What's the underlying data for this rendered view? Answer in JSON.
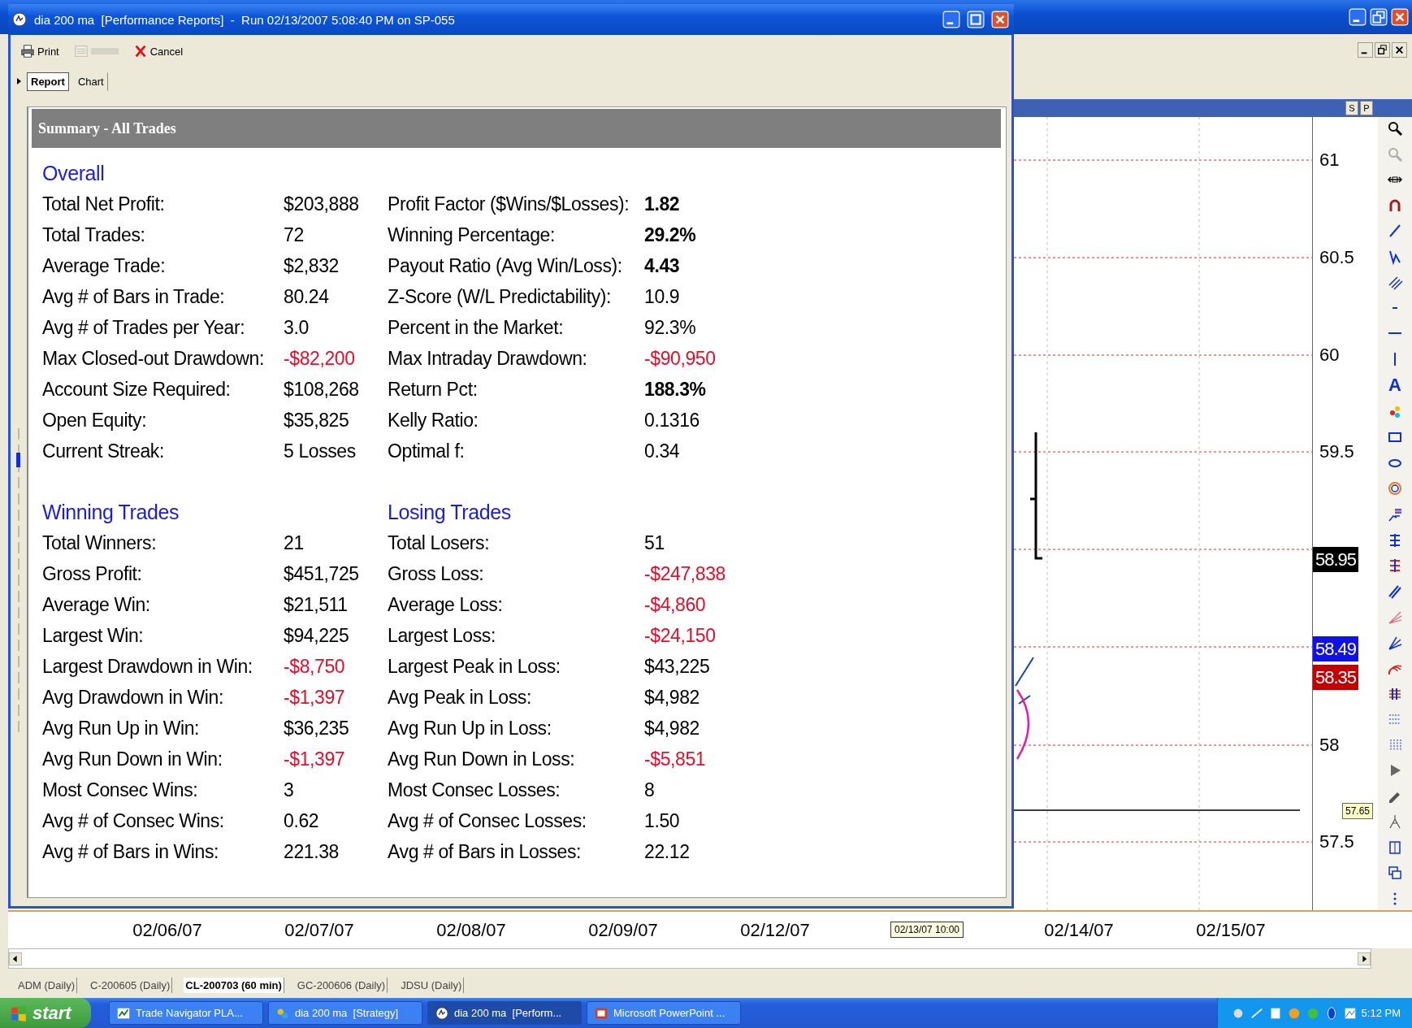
{
  "report_window": {
    "title": "dia 200 ma  [Performance Reports]  -  Run 02/13/2007 5:08:40 PM on SP-055",
    "toolbar": [
      {
        "kind": "print",
        "label": "Print",
        "disabled": false
      },
      {
        "kind": "sheet",
        "disabled": true
      },
      {
        "kind": "cancel",
        "label": "Cancel",
        "disabled": false
      }
    ],
    "tabs": [
      {
        "label": "Report",
        "selected": true
      },
      {
        "label": "Chart",
        "selected": false
      }
    ],
    "summary_title": "Summary - All Trades",
    "sections": [
      {
        "headings": [
          "Overall"
        ],
        "rows": [
          {
            "left": {
              "label": "Total Net Profit:",
              "value": "$203,888",
              "kind": "plain"
            },
            "right": {
              "label": "Profit Factor ($Wins/$Losses):",
              "value": "1.82",
              "kind": "bold"
            }
          },
          {
            "left": {
              "label": "Total Trades:",
              "value": "72",
              "kind": "plain"
            },
            "right": {
              "label": "Winning Percentage:",
              "value": "29.2%",
              "kind": "bold"
            }
          },
          {
            "left": {
              "label": "Average Trade:",
              "value": "$2,832",
              "kind": "plain"
            },
            "right": {
              "label": "Payout Ratio (Avg Win/Loss):",
              "value": "4.43",
              "kind": "bold"
            }
          },
          {
            "left": {
              "label": "Avg # of Bars in Trade:",
              "value": "80.24",
              "kind": "plain"
            },
            "right": {
              "label": "Z-Score (W/L Predictability):",
              "value": "10.9",
              "kind": "plain"
            }
          },
          {
            "left": {
              "label": "Avg # of Trades per Year:",
              "value": "3.0",
              "kind": "plain"
            },
            "right": {
              "label": "Percent in the Market:",
              "value": "92.3%",
              "kind": "plain"
            }
          },
          {
            "left": {
              "label": "Max Closed-out Drawdown:",
              "value": "-$82,200",
              "kind": "negative"
            },
            "right": {
              "label": "Max Intraday Drawdown:",
              "value": "-$90,950",
              "kind": "negative"
            }
          },
          {
            "left": {
              "label": "Account Size Required:",
              "value": "$108,268",
              "kind": "plain"
            },
            "right": {
              "label": "Return Pct:",
              "value": "188.3%",
              "kind": "bold"
            }
          },
          {
            "left": {
              "label": "Open Equity:",
              "value": "$35,825",
              "kind": "plain"
            },
            "right": {
              "label": "Kelly Ratio:",
              "value": "0.1316",
              "kind": "plain"
            }
          },
          {
            "left": {
              "label": "Current Streak:",
              "value": "5 Losses",
              "kind": "plain"
            },
            "right": {
              "label": "Optimal f:",
              "value": "0.34",
              "kind": "plain"
            }
          }
        ]
      },
      {
        "headings": [
          "Winning Trades",
          "Losing Trades"
        ],
        "rows": [
          {
            "left": {
              "label": "Total Winners:",
              "value": "21",
              "kind": "plain"
            },
            "right": {
              "label": "Total Losers:",
              "value": "51",
              "kind": "plain"
            }
          },
          {
            "left": {
              "label": "Gross Profit:",
              "value": "$451,725",
              "kind": "plain"
            },
            "right": {
              "label": "Gross Loss:",
              "value": "-$247,838",
              "kind": "negative"
            }
          },
          {
            "left": {
              "label": "Average Win:",
              "value": "$21,511",
              "kind": "plain"
            },
            "right": {
              "label": "Average Loss:",
              "value": "-$4,860",
              "kind": "negative"
            }
          },
          {
            "left": {
              "label": "Largest Win:",
              "value": "$94,225",
              "kind": "plain"
            },
            "right": {
              "label": "Largest Loss:",
              "value": "-$24,150",
              "kind": "negative"
            }
          },
          {
            "left": {
              "label": "Largest Drawdown in Win:",
              "value": "-$8,750",
              "kind": "negative"
            },
            "right": {
              "label": "Largest Peak in Loss:",
              "value": "$43,225",
              "kind": "plain"
            }
          },
          {
            "left": {
              "label": "Avg Drawdown in Win:",
              "value": "-$1,397",
              "kind": "negative"
            },
            "right": {
              "label": "Avg Peak in Loss:",
              "value": "$4,982",
              "kind": "plain"
            }
          },
          {
            "left": {
              "label": "Avg Run Up in Win:",
              "value": "$36,235",
              "kind": "plain"
            },
            "right": {
              "label": "Avg Run Up in Loss:",
              "value": "$4,982",
              "kind": "plain"
            }
          },
          {
            "left": {
              "label": "Avg Run Down in Win:",
              "value": "-$1,397",
              "kind": "negative"
            },
            "right": {
              "label": "Avg Run Down in Loss:",
              "value": "-$5,851",
              "kind": "negative"
            }
          },
          {
            "left": {
              "label": "Most Consec Wins:",
              "value": "3",
              "kind": "plain"
            },
            "right": {
              "label": "Most Consec Losses:",
              "value": "8",
              "kind": "plain"
            }
          },
          {
            "left": {
              "label": "Avg # of Consec Wins:",
              "value": "0.62",
              "kind": "plain"
            },
            "right": {
              "label": "Avg # of Consec Losses:",
              "value": "1.50",
              "kind": "plain"
            }
          },
          {
            "left": {
              "label": "Avg # of Bars in Wins:",
              "value": "221.38",
              "kind": "plain"
            },
            "right": {
              "label": "Avg # of Bars in Losses:",
              "value": "22.12",
              "kind": "plain"
            }
          }
        ]
      }
    ]
  },
  "chart": {
    "panel_buttons": [
      "S",
      "P"
    ],
    "price_labels": [
      "61",
      "60.5",
      "60",
      "59.5",
      "58",
      "57.5"
    ],
    "price_tags": [
      {
        "text": "58.95",
        "color": "#000000"
      },
      {
        "text": "58.49",
        "color": "#1010e8"
      },
      {
        "text": "58.35",
        "color": "#c00000"
      }
    ],
    "cursor_tag": "57.65",
    "text_tool": "A",
    "dates": [
      {
        "text": "02/06/07",
        "kind": "date"
      },
      {
        "text": "02/07/07",
        "kind": "date"
      },
      {
        "text": "02/08/07",
        "kind": "date"
      },
      {
        "text": "02/09/07",
        "kind": "date"
      },
      {
        "text": "02/12/07",
        "kind": "date"
      },
      {
        "text": "02/13/07 10:00",
        "kind": "tooltip"
      },
      {
        "text": "02/14/07",
        "kind": "date"
      },
      {
        "text": "02/15/07",
        "kind": "date"
      }
    ]
  },
  "sheet_tabs": [
    {
      "label": "ADM (Daily)",
      "selected": false
    },
    {
      "label": "C-200605 (Daily)",
      "selected": false
    },
    {
      "label": "CL-200703 (60 min)",
      "selected": true
    },
    {
      "label": "GC-200606 (Daily)",
      "selected": false
    },
    {
      "label": "JDSU (Daily)",
      "selected": false
    }
  ],
  "taskbar": {
    "start": "start",
    "items": [
      {
        "label": "Trade Navigator PLA...",
        "selected": false
      },
      {
        "label": "dia 200 ma  [Strategy]",
        "selected": false
      },
      {
        "label": "dia 200 ma  [Perform...",
        "selected": true
      },
      {
        "label": "Microsoft PowerPoint ...",
        "selected": false
      }
    ],
    "clock": "5:12 PM"
  }
}
